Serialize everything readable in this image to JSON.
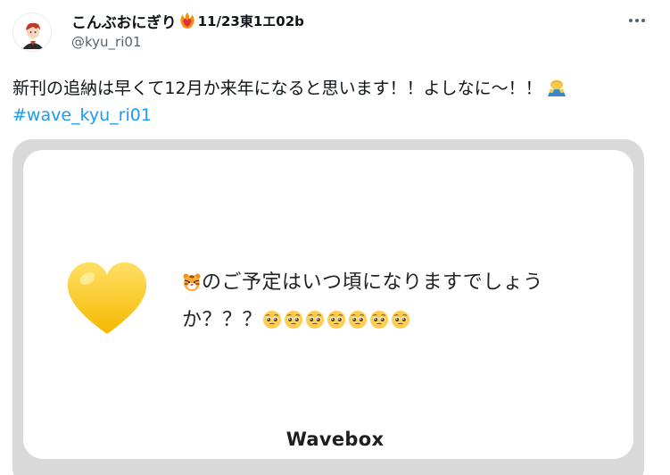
{
  "tweet": {
    "author": {
      "display_name": "こんぶおにぎり",
      "display_suffix": "11/23東1エ02b",
      "handle": "@kyu_ri01",
      "name_icon": "heart-on-fire-icon",
      "avatar": "avatar-character-icon"
    },
    "more_icon": "more-dots-icon",
    "text": "新刊の追納は早くて12月か来年になると思います！！よしなに〜！！",
    "text_emoji": "person-bowing-emoji",
    "hashtag": "#wave_kyu_ri01",
    "card": {
      "heart_icon": "yellow-heart-icon",
      "message_line1": "のご予定はいつ頃になりますでしょう",
      "message_line1_icon": "tiger-face-icon",
      "message_line2": "か？？？",
      "pleading_face_icon": "pleading-face-icon",
      "pleading_count": 7,
      "brand": "Wavebox"
    },
    "colors": {
      "link": "#1d9bf0",
      "secondary_text": "#536471",
      "card_border": "#d9d9d9",
      "heart": "#fcc419"
    }
  }
}
